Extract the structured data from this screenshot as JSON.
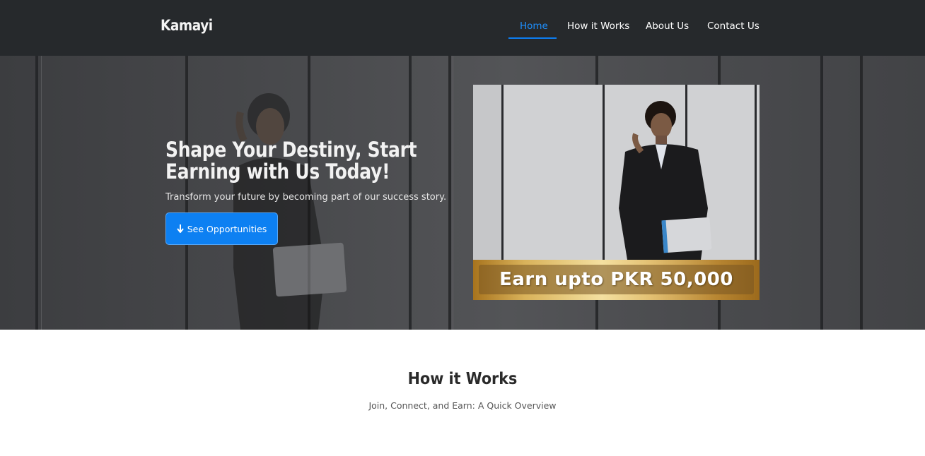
{
  "navbar": {
    "brand": "Kamayi",
    "links": [
      {
        "label": "Home",
        "active": true
      },
      {
        "label": "How it Works",
        "active": false
      },
      {
        "label": "About Us",
        "active": false
      },
      {
        "label": "Contact Us",
        "active": false
      }
    ]
  },
  "hero": {
    "title": "Shape Your Destiny, Start Earning with Us Today!",
    "subtitle": "Transform your future by becoming part of our success story.",
    "cta_label": "See Opportunities",
    "cta_icon": "arrow-down-icon",
    "banner_text": "Earn upto PKR 50,000"
  },
  "how_it_works": {
    "title": "How it Works",
    "subtitle": "Join, Connect, and Earn: A Quick Overview"
  },
  "colors": {
    "navbar_bg": "#26292c",
    "accent": "#0d80f2",
    "active_link": "#1e90ff",
    "gold": "#d9b25a"
  }
}
